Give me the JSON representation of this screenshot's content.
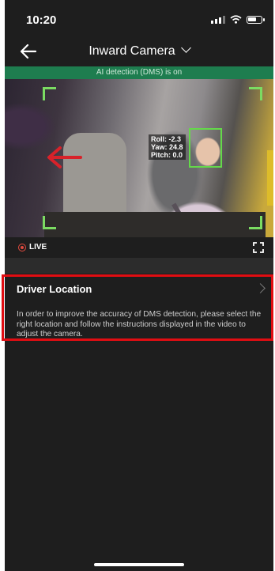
{
  "status_bar": {
    "time": "10:20"
  },
  "header": {
    "title": "Inward Camera"
  },
  "banner": {
    "text": "AI detection (DMS) is on"
  },
  "video": {
    "overlay": [
      "Roll: -2.3",
      "Yaw: 24.8",
      "Pitch: 0.0"
    ],
    "live_label": "LIVE"
  },
  "driver_location": {
    "title": "Driver Location",
    "description": "In order to improve the accuracy of DMS detection, please select the right location and follow the instructions displayed in the video to adjust the camera."
  },
  "colors": {
    "banner": "#1e7d4f",
    "highlight": "#e10d12",
    "detection": "#7bdc62"
  }
}
